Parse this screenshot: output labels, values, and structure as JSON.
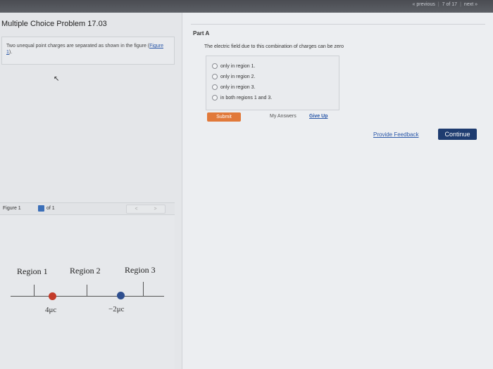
{
  "pager": {
    "previous": "« previous",
    "position": "7 of 17",
    "next": "next »"
  },
  "problem": {
    "title": "Multiple Choice Problem 17.03",
    "text_prefix": "Two unequal point charges are separated as shown in the figure (",
    "figure_link": "Figure 1",
    "text_suffix": ")."
  },
  "figure": {
    "label": "Figure 1",
    "of": "of 1",
    "nav_prev": "<",
    "nav_next": ">",
    "regions": [
      "Region 1",
      "Region 2",
      "Region 3"
    ],
    "charges": [
      {
        "label": "4μc",
        "color": "#c33b2a"
      },
      {
        "label": "−2μc",
        "color": "#2f4f8f"
      }
    ]
  },
  "part": {
    "title": "Part A",
    "question": "The electric field due to this combination of charges can be zero",
    "options": [
      "only in region 1.",
      "only in region 2.",
      "only in region 3.",
      "in both regions 1 and 3."
    ],
    "submit": "Submit",
    "my_answers": "My Answers",
    "give_up": "Give Up"
  },
  "footer": {
    "feedback": "Provide Feedback",
    "continue": "Continue"
  }
}
